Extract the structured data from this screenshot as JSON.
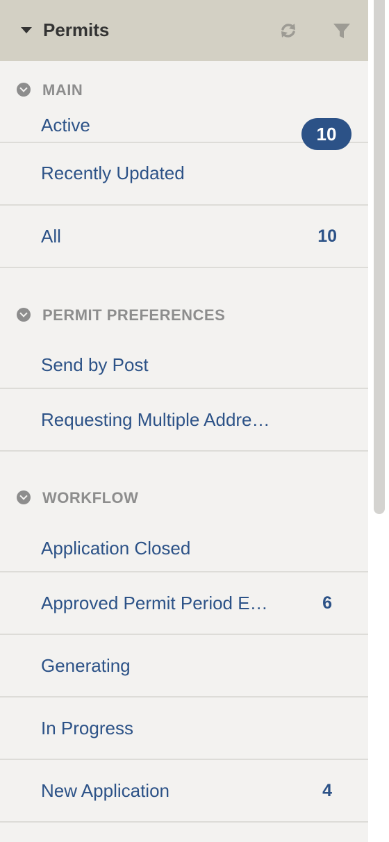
{
  "header": {
    "title": "Permits"
  },
  "sections": [
    {
      "label": "MAIN",
      "items": [
        {
          "label": "Active",
          "count": "10"
        },
        {
          "label": "Recently Updated",
          "count": ""
        },
        {
          "label": "All",
          "count": "10"
        }
      ]
    },
    {
      "label": "PERMIT PREFERENCES",
      "items": [
        {
          "label": "Send by Post",
          "count": ""
        },
        {
          "label": "Requesting Multiple Addre…",
          "count": ""
        }
      ]
    },
    {
      "label": "WORKFLOW",
      "items": [
        {
          "label": "Application Closed",
          "count": ""
        },
        {
          "label": "Approved Permit Period E…",
          "count": "6"
        },
        {
          "label": "Generating",
          "count": ""
        },
        {
          "label": "In Progress",
          "count": ""
        },
        {
          "label": "New Application",
          "count": "4"
        }
      ]
    }
  ],
  "icons": {
    "collapse": "caret-down-icon",
    "refresh": "refresh-icon",
    "filter": "filter-icon",
    "section_toggle": "chevron-down-circle-icon"
  },
  "colors": {
    "header_bg": "#d3d0c4",
    "panel_bg": "#f3f2f0",
    "link": "#2c5287",
    "section_label": "#8d8d8d",
    "badge_bg": "#2c5287"
  }
}
